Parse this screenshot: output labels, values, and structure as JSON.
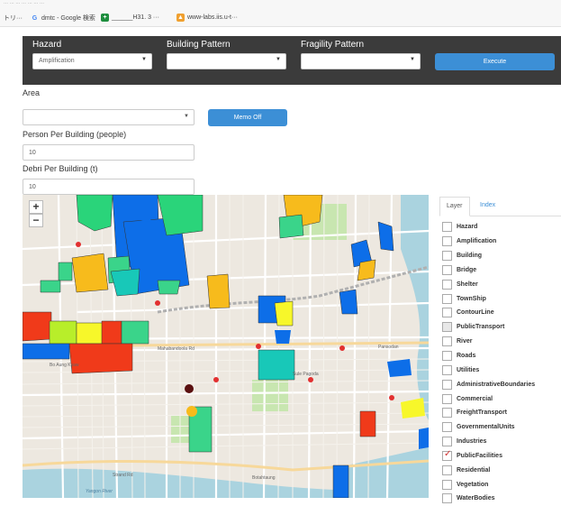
{
  "bookmarks": {
    "truncated_url": "... ... ... ... ... ... ...",
    "prefix": "トリ···",
    "items": [
      {
        "icon": "google-icon",
        "label": "dmtc - Google 検索"
      },
      {
        "icon": "sheets-icon",
        "label": "______H31. 3 ···"
      },
      {
        "icon": "web-icon",
        "label": "www-labs.iis.u-t···"
      }
    ]
  },
  "toolbar": {
    "hazard_label": "Hazard",
    "hazard_value": "Amplification",
    "building_label": "Building Pattern",
    "building_value": "",
    "fragility_label": "Fragility Pattern",
    "fragility_value": "",
    "execute_label": "Execute"
  },
  "form": {
    "area_label": "Area",
    "area_value": "",
    "memo_label": "Memo Off",
    "person_label": "Person Per Building (people)",
    "person_value": "10",
    "debri_label": "Debri Per Building (t)",
    "debri_value": "10"
  },
  "map": {
    "zoom_in": "+",
    "zoom_out": "−",
    "street_labels": [
      "Bo Aung Kyaw",
      "Mahabandoola Rd",
      "Botahtaung",
      "Pansodan",
      "Sule Pagoda",
      "Strand Rd",
      "Yangon River"
    ],
    "colors": {
      "water": "#aad3df",
      "road": "#ffffff",
      "park": "#c8e6b0",
      "rail": "#b0b0b0"
    }
  },
  "layer_panel": {
    "tab_layer": "Layer",
    "tab_index": "Index",
    "layers": [
      {
        "label": "Hazard",
        "checked": false
      },
      {
        "label": "Amplification",
        "checked": false
      },
      {
        "label": "Building",
        "checked": false
      },
      {
        "label": "Bridge",
        "checked": false
      },
      {
        "label": "Shelter",
        "checked": false
      },
      {
        "label": "TownShip",
        "checked": false
      },
      {
        "label": "ContourLine",
        "checked": false
      },
      {
        "label": "PublicTransport",
        "checked": false,
        "grey": true
      },
      {
        "label": "River",
        "checked": false
      },
      {
        "label": "Roads",
        "checked": false
      },
      {
        "label": "Utilities",
        "checked": false
      },
      {
        "label": "AdministrativeBoundaries",
        "checked": false
      },
      {
        "label": "Commercial",
        "checked": false
      },
      {
        "label": "FreightTransport",
        "checked": false
      },
      {
        "label": "GovernmentalUnits",
        "checked": false
      },
      {
        "label": "Industries",
        "checked": false
      },
      {
        "label": "PublicFacilities",
        "checked": true
      },
      {
        "label": "Residential",
        "checked": false
      },
      {
        "label": "Vegetation",
        "checked": false
      },
      {
        "label": "WaterBodies",
        "checked": false
      }
    ]
  }
}
